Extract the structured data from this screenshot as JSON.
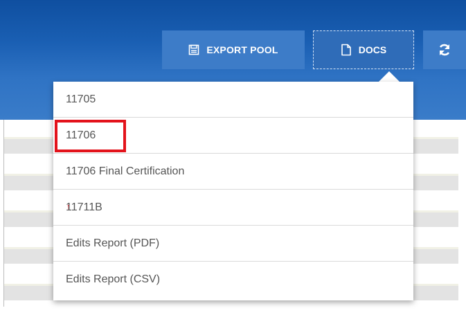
{
  "toolbar": {
    "export_pool_label": "EXPORT POOL",
    "export_pool_icon": "save-icon",
    "docs_label": "DOCS",
    "docs_icon": "document-icon",
    "refresh_icon": "refresh-icon"
  },
  "dropdown": {
    "items": [
      {
        "label": "11705"
      },
      {
        "label": "11706",
        "highlighted": true
      },
      {
        "label": "11706 Final Certification"
      },
      {
        "label": "11711B"
      },
      {
        "label": "Edits Report (PDF)"
      },
      {
        "label": "Edits Report (CSV)"
      }
    ]
  },
  "colors": {
    "header_top": "#0f4fa0",
    "header_bottom": "#3a7cc9",
    "button": "#3d7cc8",
    "highlight": "#e3131b",
    "menu_text": "#555555"
  }
}
